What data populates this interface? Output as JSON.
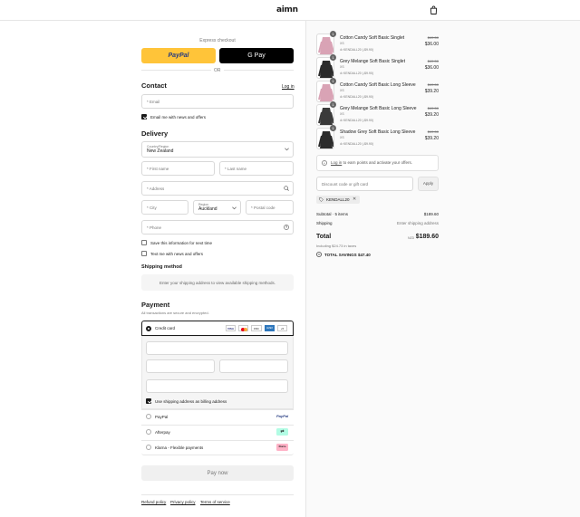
{
  "header": {
    "logo": "aimn"
  },
  "express": {
    "title": "Express checkout",
    "paypal": "PayPal",
    "gpay": "G Pay",
    "or": "OR"
  },
  "contact": {
    "title": "Contact",
    "login": "Log in",
    "email_placeholder": "* Email",
    "news": "Email me with news and offers"
  },
  "delivery": {
    "title": "Delivery",
    "country_label": "Country/Region",
    "country": "New Zealand",
    "first_name": "* First name",
    "last_name": "* Last name",
    "address": "* Address",
    "city": "* City",
    "region_label": "Region",
    "region": "Auckland",
    "postal": "* Postal code",
    "phone": "* Phone",
    "save_info": "Save this information for next time",
    "text_me": "Text me with news and offers"
  },
  "shipping": {
    "title": "Shipping method",
    "note": "Enter your shipping address to view available shipping methods."
  },
  "payment": {
    "title": "Payment",
    "sub": "All transactions are secure and encrypted.",
    "card": "Credit card",
    "billing": "Use shipping address as billing address",
    "paypal": "PayPal",
    "afterpay": "Afterpay",
    "klarna": "Klarna - Flexible payments",
    "pay_now": "Pay now",
    "badges": [
      "VISA",
      "MC",
      "DISC",
      "AMEX",
      "+5"
    ]
  },
  "footer": {
    "refund": "Refund policy",
    "privacy": "Privacy policy",
    "terms": "Terms of service"
  },
  "cart": {
    "items": [
      {
        "name": "Cotton Candy Soft Basic Singlet",
        "size": "XS",
        "discount": "KENDALL20 (-$9.90)",
        "old": "$49.50",
        "price": "$36.00",
        "qty": "1",
        "color": "#d9a3b5"
      },
      {
        "name": "Grey Melange Soft Basic Singlet",
        "size": "XS",
        "discount": "KENDALL20 (-$9.90)",
        "old": "$49.50",
        "price": "$36.00",
        "qty": "1",
        "color": "#2b2b2b"
      },
      {
        "name": "Cotton Candy Soft Basic Long Sleeve",
        "size": "XS",
        "discount": "KENDALL20 (-$9.90)",
        "old": "$49.50",
        "price": "$39.20",
        "qty": "1",
        "color": "#d9a3b5"
      },
      {
        "name": "Grey Melange Soft Basic Long Sleeve",
        "size": "XS",
        "discount": "KENDALL20 (-$9.90)",
        "old": "$49.50",
        "price": "$39.20",
        "qty": "1",
        "color": "#3a3a3a"
      },
      {
        "name": "Shadow Grey Soft Basic Long Sleeve",
        "size": "XS",
        "discount": "KENDALL20 (-$9.90)",
        "old": "$49.50",
        "price": "$39.20",
        "qty": "1",
        "color": "#2b2b2b"
      }
    ],
    "login_link": "Log in",
    "login_rest": " to earn points and activate your offers.",
    "discount_placeholder": "Discount code or gift card",
    "apply": "Apply",
    "code": "KENDALL20",
    "subtotal_label": "Subtotal · 5 items",
    "subtotal": "$189.60",
    "shipping_label": "Shipping",
    "shipping_value": "Enter shipping address",
    "total_label": "Total",
    "currency": "NZD",
    "total": "$189.60",
    "taxes": "Including $24.73 in taxes",
    "savings_label": "TOTAL SAVINGS",
    "savings": "$47.40"
  }
}
